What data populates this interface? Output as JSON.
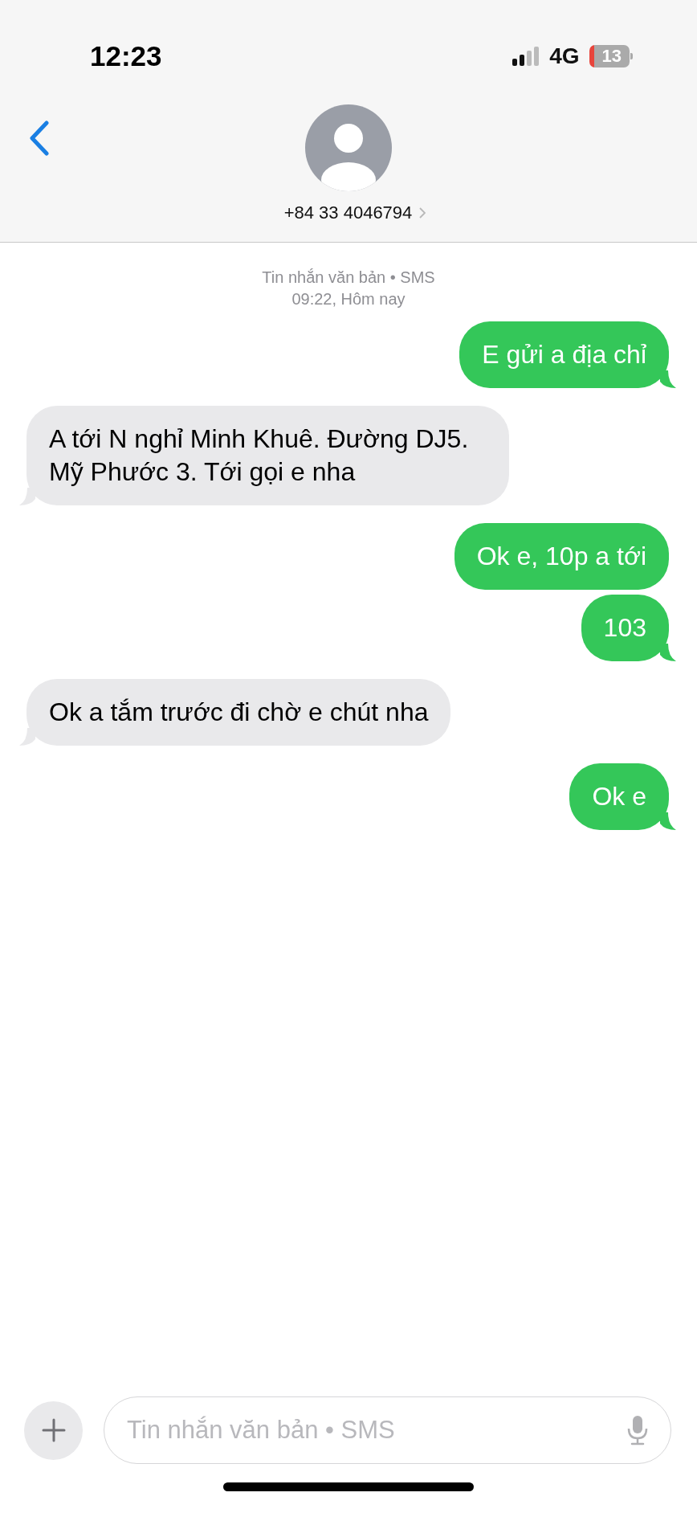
{
  "status_bar": {
    "time": "12:23",
    "network": "4G",
    "battery": "13"
  },
  "header": {
    "contact": "+84 33 4046794"
  },
  "conversation": {
    "service": "Tin nhắn văn bản • SMS",
    "timestamp": "09:22, Hôm nay"
  },
  "messages": [
    {
      "kind": "sent",
      "text": "E gửi a địa chỉ",
      "tail": true
    },
    {
      "kind": "received",
      "text": "A tới N nghỉ Minh Khuê. Đường DJ5. Mỹ Phước 3. Tới gọi e nha",
      "tail": true
    },
    {
      "kind": "sent",
      "text": "Ok e, 10p a tới",
      "tail": false
    },
    {
      "kind": "sent",
      "text": "103",
      "tail": true
    },
    {
      "kind": "received",
      "text": "Ok a tắm trước đi chờ e chút nha",
      "tail": true
    },
    {
      "kind": "sent",
      "text": "Ok e",
      "tail": true
    }
  ],
  "composer": {
    "placeholder": "Tin nhắn văn bản • SMS"
  }
}
